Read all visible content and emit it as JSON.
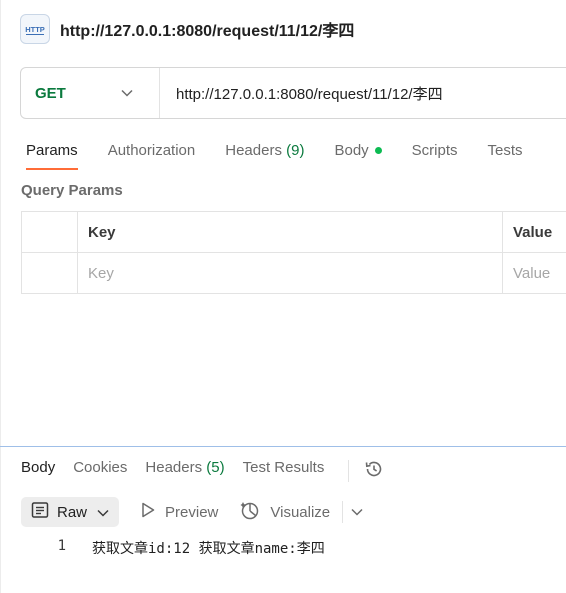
{
  "request": {
    "title": "http://127.0.0.1:8080/request/11/12/李四",
    "method": "GET",
    "url": "http://127.0.0.1:8080/request/11/12/李四"
  },
  "request_tabs": [
    {
      "label": "Params",
      "active": true
    },
    {
      "label": "Authorization"
    },
    {
      "label": "Headers",
      "count": "(9)"
    },
    {
      "label": "Body",
      "indicator": "green-dot"
    },
    {
      "label": "Scripts"
    },
    {
      "label": "Tests"
    }
  ],
  "query_params": {
    "section_label": "Query Params",
    "columns": [
      "Key",
      "Value"
    ],
    "placeholder_row": [
      "Key",
      "Value"
    ]
  },
  "response_tabs": [
    {
      "label": "Body",
      "active": true
    },
    {
      "label": "Cookies"
    },
    {
      "label": "Headers",
      "count": "(5)"
    },
    {
      "label": "Test Results"
    }
  ],
  "response_toolbar": {
    "format": "Raw",
    "preview": "Preview",
    "visualize": "Visualize"
  },
  "response_body": {
    "lines": [
      {
        "number": "1",
        "text": "获取文章id:12 获取文章name:李四"
      }
    ]
  },
  "colors": {
    "method_get": "#0b7a3e",
    "active_tab_underline": "#ff6c37",
    "body_dot": "#0cbb52",
    "count": "#0b7a3e"
  }
}
